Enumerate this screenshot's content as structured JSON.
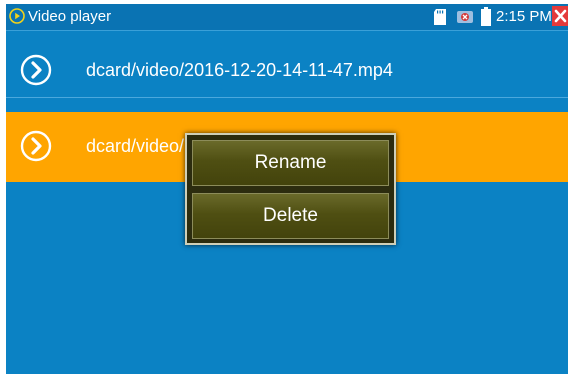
{
  "titlebar": {
    "title": "Video player",
    "time": "2:15 PM"
  },
  "icons": {
    "app": "play-circle-icon",
    "sd_card": "sd-card-icon",
    "usb": "usb-icon",
    "battery": "battery-icon",
    "close": "close-icon",
    "row": "chevron-right-circle-icon"
  },
  "files": [
    {
      "label": "dcard/video/2016-12-20-14-11-47.mp4",
      "selected": false
    },
    {
      "label": "dcard/video/",
      "selected": true
    }
  ],
  "context_menu": {
    "items": [
      "Rename",
      "Delete"
    ]
  },
  "colors": {
    "background": "#0b82c4",
    "selected_row": "#ffa500",
    "menu_background": "#4f4f12",
    "close_button": "#e43a3a"
  }
}
